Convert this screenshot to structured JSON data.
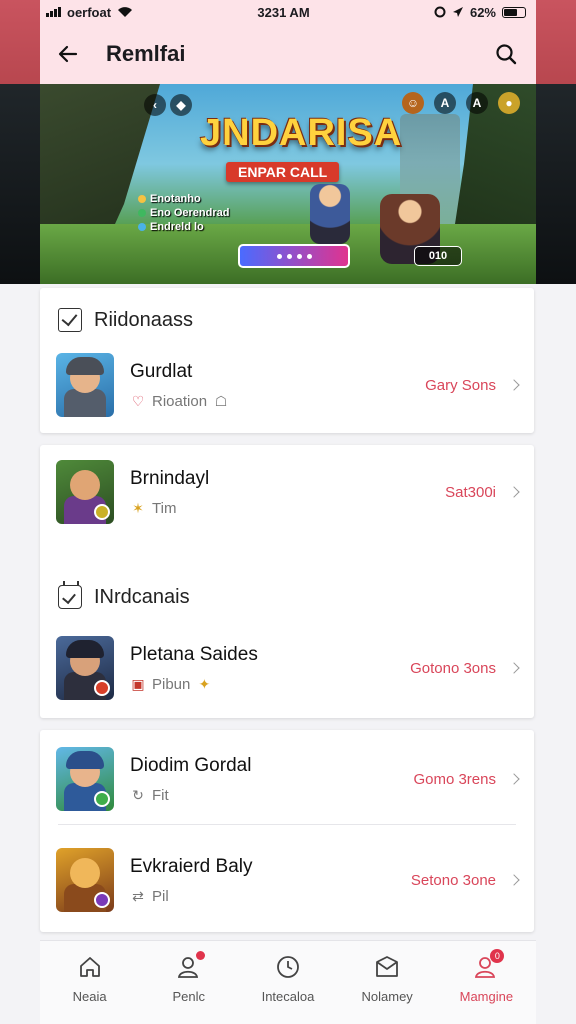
{
  "status_bar": {
    "carrier": "oerfoat",
    "time": "3231 AM",
    "battery": "62%"
  },
  "header": {
    "title": "Remlfai"
  },
  "banner": {
    "logo": "JNDARISA",
    "subtitle": "ENPAR CALL",
    "info_items": [
      "Enotanho",
      "Eno Oerendrad",
      "Endreld lo"
    ],
    "counter": "010",
    "top_left_icons": [
      "back-icon",
      "gem-icon"
    ],
    "top_right_icons": [
      "avatar-icon",
      "letter-icon",
      "hat-icon",
      "coin-icon"
    ],
    "top_right_labels": [
      "",
      "A",
      "A",
      ""
    ]
  },
  "section1": {
    "title": "Riidonaass",
    "items": [
      {
        "title": "Gurdlat",
        "sub": "Rioation",
        "action": "Gary Sons"
      }
    ]
  },
  "section2_first": {
    "title": "Brnindayl",
    "sub": "Tim",
    "action": "Sat300i"
  },
  "section2": {
    "title": "INrdcanais",
    "items": [
      {
        "title": "Pletana Saides",
        "sub": "Pibun",
        "action": "Gotono 3ons"
      }
    ]
  },
  "section3": {
    "items": [
      {
        "title": "Diodim Gordal",
        "sub": "Fit",
        "action": "Gomo 3rens"
      },
      {
        "title": "Evkraierd Baly",
        "sub": "Pil",
        "action": "Setono 3one"
      }
    ]
  },
  "tabs": [
    {
      "label": "Neaia",
      "icon": "home-icon"
    },
    {
      "label": "Penlc",
      "icon": "people-icon"
    },
    {
      "label": "Intecaloa",
      "icon": "clock-icon"
    },
    {
      "label": "Nolamey",
      "icon": "mail-icon"
    },
    {
      "label": "Mamgine",
      "icon": "profile-icon",
      "active": true
    }
  ],
  "colors": {
    "accent": "#d9465a",
    "header_bg": "#fde3e8"
  }
}
